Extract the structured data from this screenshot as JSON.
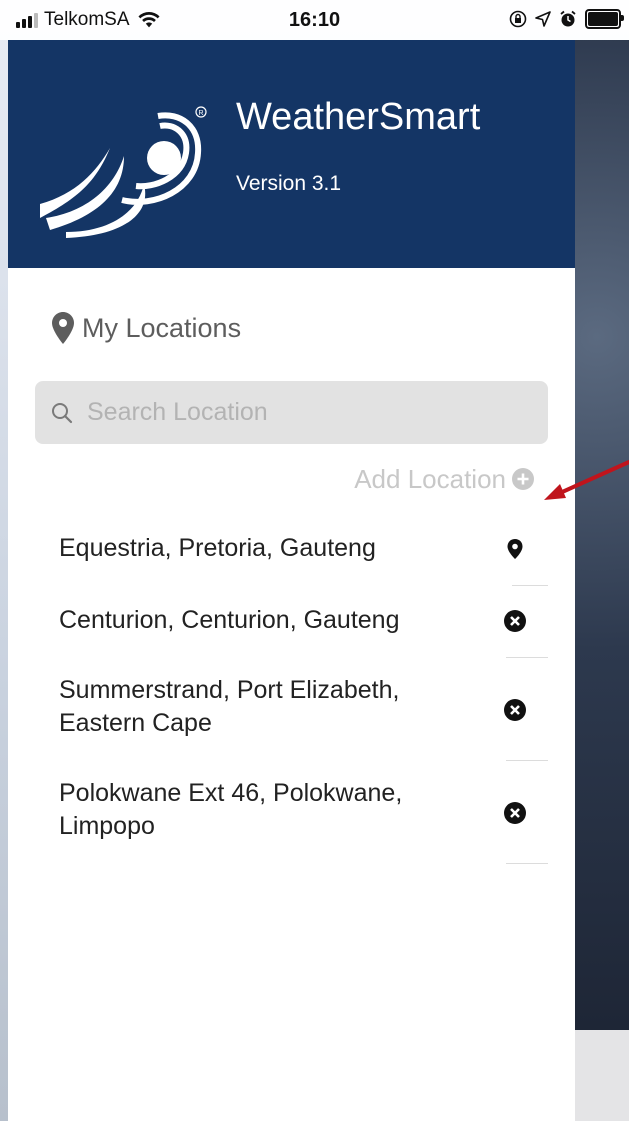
{
  "status_bar": {
    "carrier": "TelkomSA",
    "time": "16:10",
    "icons": [
      "signal-icon",
      "wifi-icon",
      "rotation-lock-icon",
      "location-arrow-icon",
      "alarm-icon",
      "battery-icon"
    ]
  },
  "drawer": {
    "app_name": "WeatherSmart",
    "version": "Version 3.1",
    "header_color": "#143565"
  },
  "my_locations": {
    "title": "My Locations",
    "search_placeholder": "Search Location",
    "add_label": "Add Location"
  },
  "locations": [
    {
      "line1": "Equestria, Pretoria, Gauteng",
      "line2": "",
      "icon": "location-pin-icon"
    },
    {
      "line1": "Centurion, Centurion, Gauteng",
      "line2": "",
      "icon": "remove-circle-icon"
    },
    {
      "line1": "Summerstrand, Port Elizabeth,",
      "line2": "Eastern Cape",
      "icon": "remove-circle-icon"
    },
    {
      "line1": "Polokwane Ext 46, Polokwane,",
      "line2": "Limpopo",
      "icon": "remove-circle-icon"
    }
  ],
  "annotation": {
    "arrow_color": "#c0141c"
  }
}
